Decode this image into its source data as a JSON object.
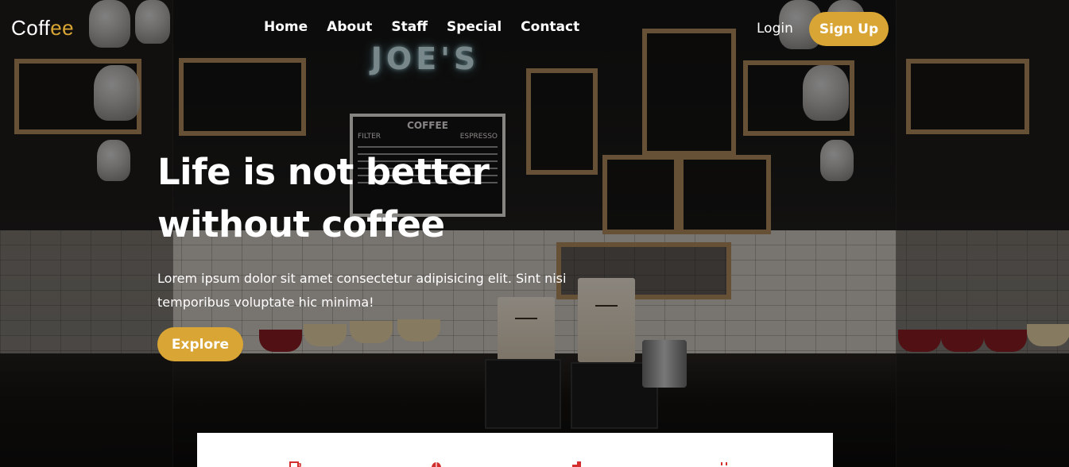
{
  "header": {
    "logo_main": "Coff",
    "logo_accent": "ee",
    "nav": [
      "Home",
      "About",
      "Staff",
      "Special",
      "Contact"
    ],
    "login_label": "Login",
    "signup_label": "Sign Up"
  },
  "background": {
    "sign_text": "JOE'S",
    "menu_board": {
      "title": "COFFEE",
      "col_left": "FILTER",
      "col_right": "ESPRESSO"
    }
  },
  "hero": {
    "title_line1": "Life is not better",
    "title_line2": "without coffee",
    "text": "Lorem ipsum dolor sit amet consectetur adipisicing elit. Sint nisi temporibus voluptate hic minima!",
    "explore_label": "Explore"
  },
  "feature_icons": [
    "coffee-cup-icon",
    "coffee-bean-icon",
    "coffee-maker-icon",
    "coffee-steam-icon"
  ],
  "colors": {
    "accent": "#d9a534",
    "icon_red": "#d32f2f",
    "text": "#ffffff",
    "card": "#ffffff"
  }
}
